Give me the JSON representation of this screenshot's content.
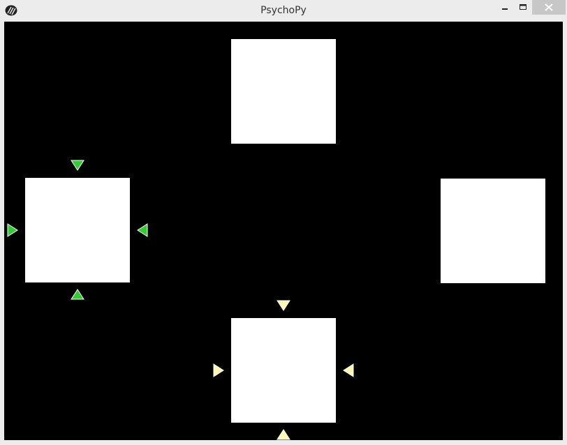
{
  "window": {
    "title": "PsychoPy",
    "controls": {
      "minimize_icon": "minimize-icon",
      "maximize_icon": "maximize-icon",
      "close_icon": "close-icon"
    }
  },
  "stimuli": {
    "squares": [
      "top-square",
      "left-square",
      "right-square",
      "bottom-square"
    ],
    "square_color": "#ffffff",
    "background_color": "#000000",
    "cue_left": {
      "color": "#33cc33",
      "arrow_count": 4
    },
    "cue_bottom": {
      "color": "#fff8b0",
      "arrow_count": 4
    }
  }
}
